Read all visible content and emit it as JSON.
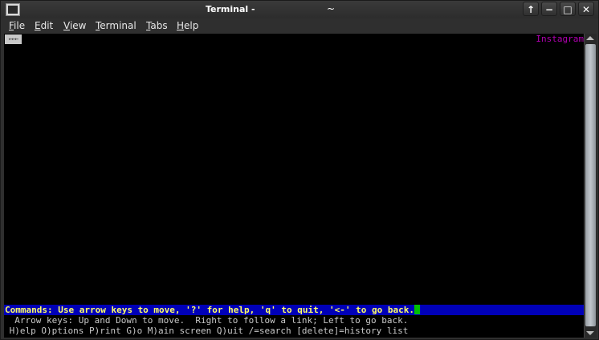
{
  "window": {
    "title": "Terminal -",
    "subtitle": "~",
    "buttons": {
      "up_icon": "↑",
      "minimize_icon": "−",
      "maximize_icon": "□",
      "close_icon": "✕"
    }
  },
  "menubar": {
    "items": [
      {
        "first": "F",
        "rest": "ile"
      },
      {
        "first": "E",
        "rest": "dit"
      },
      {
        "first": "V",
        "rest": "iew"
      },
      {
        "first": "T",
        "rest": "erminal"
      },
      {
        "first": "T",
        "rest": "abs"
      },
      {
        "first": "H",
        "rest": "elp"
      }
    ]
  },
  "terminal": {
    "back_mark": "←←←",
    "page_title": "Instagram",
    "status_line": "Commands: Use arrow keys to move, '?' for help, 'q' to quit, '<-' to go back.",
    "help_line_1": "  Arrow keys: Up and Down to move.  Right to follow a link; Left to go back.",
    "help_line_2": " H)elp O)ptions P)rint G)o M)ain screen Q)uit /=search [delete]=history list"
  },
  "colors": {
    "terminal_bg": "#000000",
    "status_bg": "#0000b8",
    "status_fg": "#ffff66",
    "page_title_fg": "#b000b0",
    "cursor": "#00c000"
  }
}
